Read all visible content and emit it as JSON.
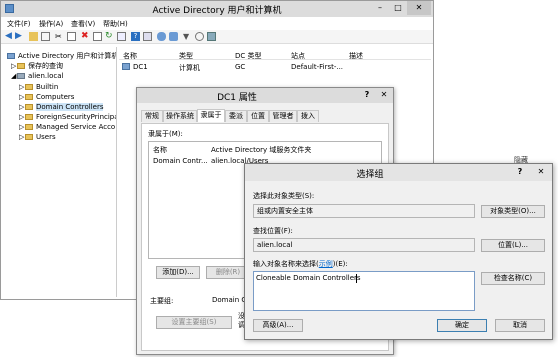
{
  "main_window": {
    "title": "Active Directory 用户和计算机",
    "menu": [
      "文件(F)",
      "操作(A)",
      "查看(V)",
      "帮助(H)"
    ],
    "tree": {
      "root": "Active Directory 用户和计算机",
      "saved_queries": "保存的查询",
      "domain": "alien.local",
      "children": [
        "Builtin",
        "Computers",
        "Domain Controllers",
        "ForeignSecurityPrincipa",
        "Managed Service Acco",
        "Users"
      ]
    },
    "list": {
      "columns": [
        "名称",
        "类型",
        "DC 类型",
        "站点",
        "描述"
      ],
      "rows": [
        [
          "DC1",
          "计算机",
          "GC",
          "Default-First-...",
          ""
        ]
      ]
    },
    "side_label": "隐藏"
  },
  "props_dialog": {
    "title": "DC1 属性",
    "tabs": [
      "常规",
      "操作系统",
      "隶属于",
      "委派",
      "位置",
      "管理者",
      "拨入"
    ],
    "member_of_label": "隶属于(M):",
    "columns": [
      "名称",
      "Active Directory 域服务文件夹"
    ],
    "rows": [
      [
        "Domain Contr...",
        "alien.local/Users"
      ]
    ],
    "add_button": "添加(D)...",
    "remove_button": "删除(R)",
    "primary_group_label": "主要组:",
    "primary_group_value": "Domain Co",
    "set_primary_button": "设置主要组(S)",
    "note_fragment": "没\n调"
  },
  "select_dialog": {
    "title": "选择组",
    "object_type_label": "选择此对象类型(S):",
    "object_type_value": "组或内置安全主体",
    "object_type_button": "对象类型(O)...",
    "location_label": "查找位置(F):",
    "location_value": "alien.local",
    "location_button": "位置(L)...",
    "names_label_prefix": "输入对象名称来选择(",
    "names_label_link": "示例",
    "names_label_suffix": ")(E):",
    "names_value": "Cloneable Domain Controllers",
    "check_names_button": "检查名称(C)",
    "advanced_button": "高级(A)...",
    "ok_button": "确定",
    "cancel_button": "取消"
  },
  "colors": {
    "title_bar": "#dcdcdc",
    "select_dialog_title": "#e4e4e4",
    "link": "#0066cc",
    "folder": "#e8c35a"
  }
}
